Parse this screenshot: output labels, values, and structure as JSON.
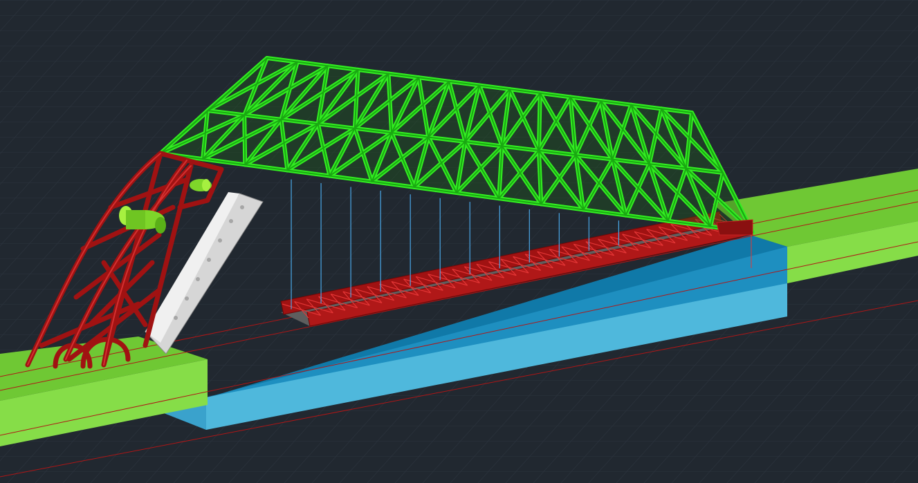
{
  "viewport": {
    "label": "",
    "colors": {
      "background": "#212830",
      "grid": "#2c343e",
      "truss_green": "#33ee22",
      "truss_green_dark": "#1aa812",
      "frame_red": "#a01212",
      "frame_red_light": "#c42222",
      "water_blue": "#4fb8dc",
      "water_blue_dark": "#1079a8",
      "bank_green": "#86dd48",
      "bank_green_dark": "#55b020",
      "panel_gray": "#d6d6d6",
      "hanger_cable": "#4aa8e8",
      "axis_line": "#b01616"
    }
  }
}
